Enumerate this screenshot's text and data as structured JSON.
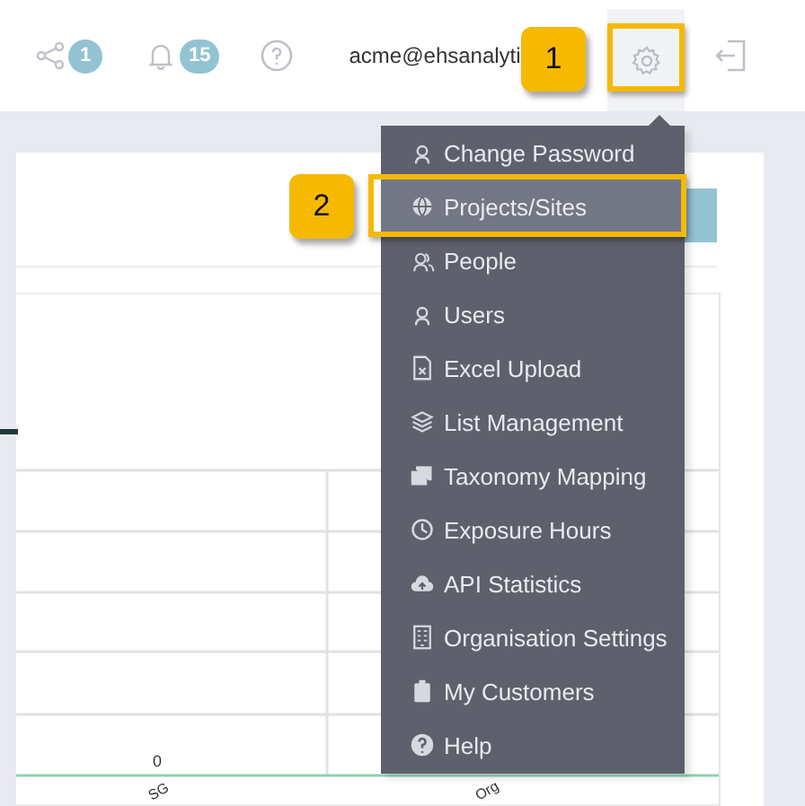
{
  "header": {
    "share": {
      "count": "1"
    },
    "notifications": {
      "count": "15"
    },
    "user": {
      "email": "acme@ehsanalyti"
    },
    "settings": {
      "open": true
    }
  },
  "settings_menu": {
    "items": [
      {
        "label": "Change Password",
        "selected": false
      },
      {
        "label": "Projects/Sites",
        "selected": true
      },
      {
        "label": "People",
        "selected": false
      },
      {
        "label": "Users",
        "selected": false
      },
      {
        "label": "Excel Upload",
        "selected": false
      },
      {
        "label": "List Management",
        "selected": false
      },
      {
        "label": "Taxonomy Mapping",
        "selected": false
      },
      {
        "label": "Exposure Hours",
        "selected": false
      },
      {
        "label": "API Statistics",
        "selected": false
      },
      {
        "label": "Organisation Settings",
        "selected": false
      },
      {
        "label": "My Customers",
        "selected": false
      },
      {
        "label": "Help",
        "selected": false
      }
    ]
  },
  "chart": {
    "value_label": "0",
    "category_labels": [
      "SG",
      "Org"
    ]
  },
  "callouts": [
    {
      "label": "1"
    },
    {
      "label": "2"
    }
  ]
}
